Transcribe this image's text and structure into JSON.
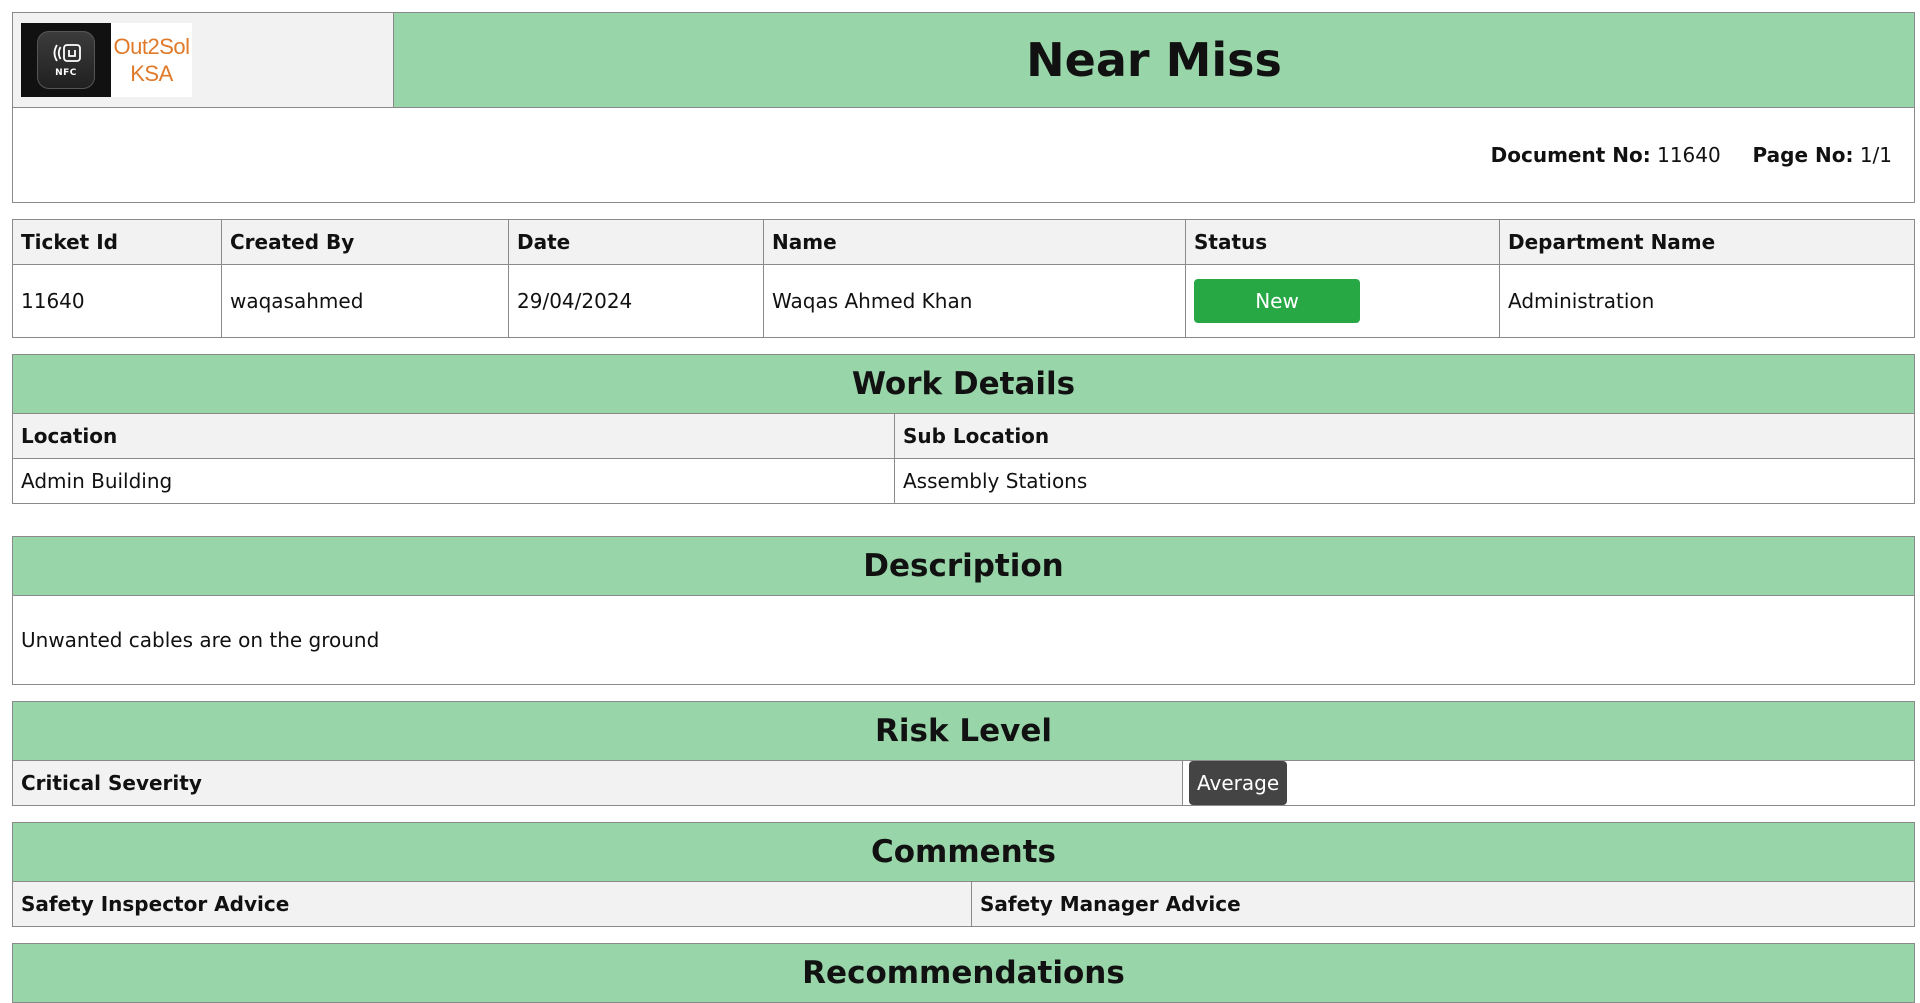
{
  "header": {
    "logo": {
      "brand_line1": "Out2Sol",
      "brand_line2": "KSA",
      "icon_text": "NFC"
    },
    "title": "Near Miss",
    "document_no_label": "Document No:",
    "document_no": "11640",
    "page_no_label": "Page No:",
    "page_no": "1/1"
  },
  "ticket": {
    "columns": [
      "Ticket Id",
      "Created By",
      "Date",
      "Name",
      "Status",
      "Department Name"
    ],
    "row": {
      "ticket_id": "11640",
      "created_by": "waqasahmed",
      "date": "29/04/2024",
      "name": "Waqas Ahmed Khan",
      "status": "New",
      "department": "Administration"
    }
  },
  "work_details": {
    "title": "Work Details",
    "columns": [
      "Location",
      "Sub Location"
    ],
    "values": [
      "Admin Building",
      "Assembly Stations"
    ]
  },
  "description": {
    "title": "Description",
    "text": "Unwanted cables are on the ground"
  },
  "risk_level": {
    "title": "Risk Level",
    "label": "Critical Severity",
    "value": "Average"
  },
  "comments": {
    "title": "Comments",
    "columns": [
      "Safety Inspector Advice",
      "Safety Manager Advice"
    ]
  },
  "recommendations": {
    "title": "Recommendations"
  },
  "colors": {
    "section_bg": "#98d5a9",
    "header_cell_bg": "#f2f2f2",
    "status_new": "#28a745",
    "badge_dark": "#444444",
    "logo_orange": "#e07a2a"
  }
}
